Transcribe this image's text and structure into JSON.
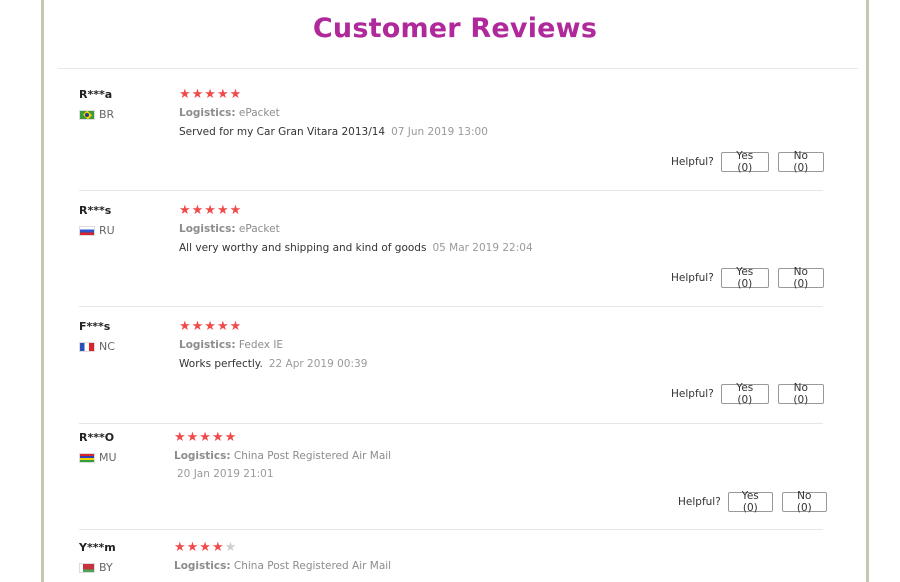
{
  "header": {
    "title": "Customer Reviews"
  },
  "helpful_label": "Helpful?",
  "reviews": [
    {
      "name": "R***a",
      "country": "BR",
      "stars": 5,
      "logistics_label": "Logistics:",
      "logistics": "ePacket",
      "text": "Served for my Car Gran Vitara 2013/14",
      "date": "07 Jun 2019 13:00",
      "yes": "Yes (0)",
      "no": "No (0)"
    },
    {
      "name": "R***s",
      "country": "RU",
      "stars": 5,
      "logistics_label": "Logistics:",
      "logistics": "ePacket",
      "text": "All very worthy and shipping and kind of goods",
      "date": "05 Mar 2019 22:04",
      "yes": "Yes (0)",
      "no": "No (0)"
    },
    {
      "name": "F***s",
      "country": "NC",
      "stars": 5,
      "logistics_label": "Logistics:",
      "logistics": "Fedex IE",
      "text": "Works perfectly.",
      "date": "22 Apr 2019 00:39",
      "yes": "Yes (0)",
      "no": "No (0)"
    },
    {
      "name": "R***O",
      "country": "MU",
      "stars": 5,
      "logistics_label": "Logistics:",
      "logistics": "China Post Registered Air Mail",
      "text": "",
      "date": "20 Jan 2019 21:01",
      "yes": "Yes (0)",
      "no": "No (0)"
    },
    {
      "name": "Y***m",
      "country": "BY",
      "stars": 4,
      "logistics_label": "Logistics:",
      "logistics": "China Post Registered Air Mail",
      "text": "",
      "date": "",
      "yes": "",
      "no": ""
    }
  ],
  "colors": {
    "title": "#b0299a",
    "star": "#f04a4a",
    "star_off": "#cfcfcf",
    "frame": "#c7c7b1"
  }
}
